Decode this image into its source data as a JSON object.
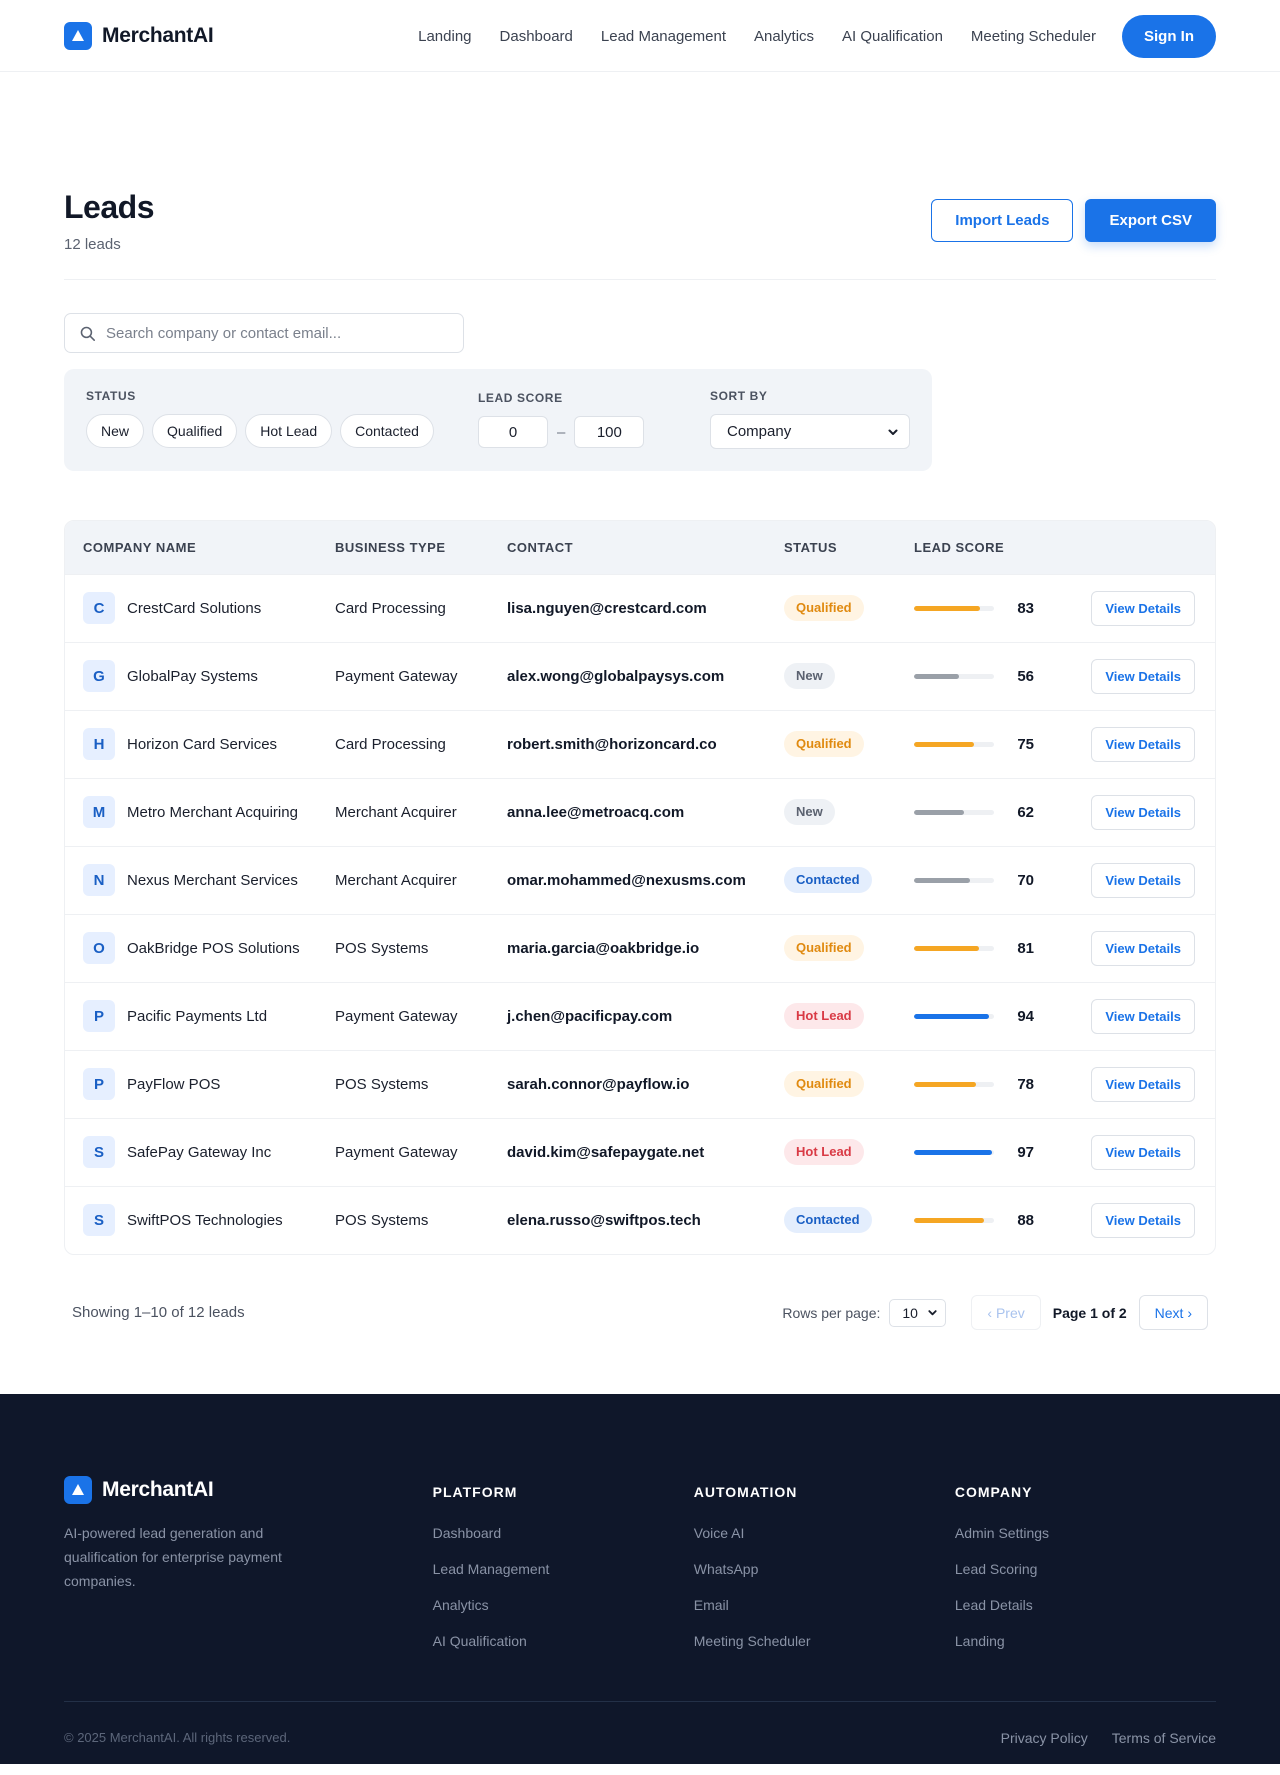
{
  "brand": {
    "name": "MerchantAI"
  },
  "nav": {
    "items": [
      "Landing",
      "Dashboard",
      "Lead Management",
      "Analytics",
      "AI Qualification",
      "Meeting Scheduler"
    ],
    "sign_in": "Sign In"
  },
  "page": {
    "title": "Leads",
    "subtitle": "12 leads",
    "import_label": "Import Leads",
    "export_label": "Export CSV"
  },
  "search": {
    "placeholder": "Search company or contact email..."
  },
  "filters": {
    "status_label": "STATUS",
    "status_chips": [
      "New",
      "Qualified",
      "Hot Lead",
      "Contacted"
    ],
    "score_label": "LEAD SCORE",
    "score_min": "0",
    "score_max": "100",
    "score_sep": "–",
    "sort_label": "SORT BY",
    "sort_value": "Company"
  },
  "table": {
    "headers": {
      "company": "COMPANY NAME",
      "type": "BUSINESS TYPE",
      "contact": "CONTACT",
      "status": "STATUS",
      "score": "LEAD SCORE"
    },
    "action_label": "View Details",
    "rows": [
      {
        "initial": "C",
        "company": "CrestCard Solutions",
        "type": "Card Processing",
        "contact": "lisa.nguyen@crestcard.com",
        "status": "Qualified",
        "score": 83
      },
      {
        "initial": "G",
        "company": "GlobalPay Systems",
        "type": "Payment Gateway",
        "contact": "alex.wong@globalpaysys.com",
        "status": "New",
        "score": 56
      },
      {
        "initial": "H",
        "company": "Horizon Card Services",
        "type": "Card Processing",
        "contact": "robert.smith@horizoncard.co",
        "status": "Qualified",
        "score": 75
      },
      {
        "initial": "M",
        "company": "Metro Merchant Acquiring",
        "type": "Merchant Acquirer",
        "contact": "anna.lee@metroacq.com",
        "status": "New",
        "score": 62
      },
      {
        "initial": "N",
        "company": "Nexus Merchant Services",
        "type": "Merchant Acquirer",
        "contact": "omar.mohammed@nexusms.com",
        "status": "Contacted",
        "score": 70
      },
      {
        "initial": "O",
        "company": "OakBridge POS Solutions",
        "type": "POS Systems",
        "contact": "maria.garcia@oakbridge.io",
        "status": "Qualified",
        "score": 81
      },
      {
        "initial": "P",
        "company": "Pacific Payments Ltd",
        "type": "Payment Gateway",
        "contact": "j.chen@pacificpay.com",
        "status": "Hot Lead",
        "score": 94
      },
      {
        "initial": "P",
        "company": "PayFlow POS",
        "type": "POS Systems",
        "contact": "sarah.connor@payflow.io",
        "status": "Qualified",
        "score": 78
      },
      {
        "initial": "S",
        "company": "SafePay Gateway Inc",
        "type": "Payment Gateway",
        "contact": "david.kim@safepaygate.net",
        "status": "Hot Lead",
        "score": 97
      },
      {
        "initial": "S",
        "company": "SwiftPOS Technologies",
        "type": "POS Systems",
        "contact": "elena.russo@swiftpos.tech",
        "status": "Contacted",
        "score": 88
      }
    ]
  },
  "colors": {
    "accent": "#1a73e8",
    "bar_high": "#1a73e8",
    "bar_mid": "#f5a623",
    "bar_low": "#9aa0a8"
  },
  "pagination": {
    "info": "Showing 1–10 of 12 leads",
    "rows_label": "Rows per page:",
    "rows_value": "10",
    "prev": "‹ Prev",
    "page_indicator": "Page 1 of 2",
    "next": "Next ›"
  },
  "footer": {
    "description": "AI-powered lead generation and qualification for enterprise payment companies.",
    "columns": [
      {
        "title": "PLATFORM",
        "links": [
          "Dashboard",
          "Lead Management",
          "Analytics",
          "AI Qualification"
        ]
      },
      {
        "title": "AUTOMATION",
        "links": [
          "Voice AI",
          "WhatsApp",
          "Email",
          "Meeting Scheduler"
        ]
      },
      {
        "title": "COMPANY",
        "links": [
          "Admin Settings",
          "Lead Scoring",
          "Lead Details",
          "Landing"
        ]
      }
    ],
    "copyright": "© 2025 MerchantAI. All rights reserved.",
    "privacy": "Privacy Policy",
    "terms": "Terms of Service"
  }
}
